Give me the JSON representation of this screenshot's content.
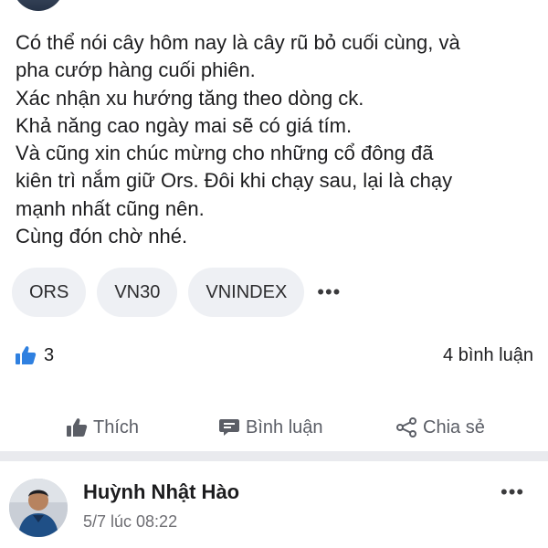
{
  "post": {
    "lines": [
      "Có thể nói cây hôm nay là cây rũ bỏ cuối cùng, và",
      "pha cướp hàng cuối phiên.",
      "Xác nhận xu hướng tăng theo dòng ck.",
      "Khả năng cao ngày mai sẽ có giá tím.",
      "Và cũng xin chúc mừng cho những cổ đông đã",
      "kiên trì nắm giữ Ors. Đôi khi chạy sau, lại là chạy",
      "mạnh nhất cũng nên.",
      "Cùng đón chờ nhé."
    ],
    "tags": [
      "ORS",
      "VN30",
      "VNINDEX"
    ],
    "more_tags": "•••",
    "like_count": "3",
    "comment_count": "4 bình luận"
  },
  "actions": {
    "like": "Thích",
    "comment": "Bình luận",
    "share": "Chia sẻ"
  },
  "comment": {
    "author": "Huỳnh Nhật Hào",
    "time": "5/7 lúc 08:22",
    "more": "•••"
  },
  "colors": {
    "like_icon": "#2f80e0",
    "action_icon": "#5b5e66",
    "tag_bg": "#eef0f4",
    "separator": "#e9eaee"
  },
  "icons": {
    "like": "thumbs-up-icon",
    "comment": "comment-icon",
    "share": "share-icon",
    "more": "more-icon"
  }
}
